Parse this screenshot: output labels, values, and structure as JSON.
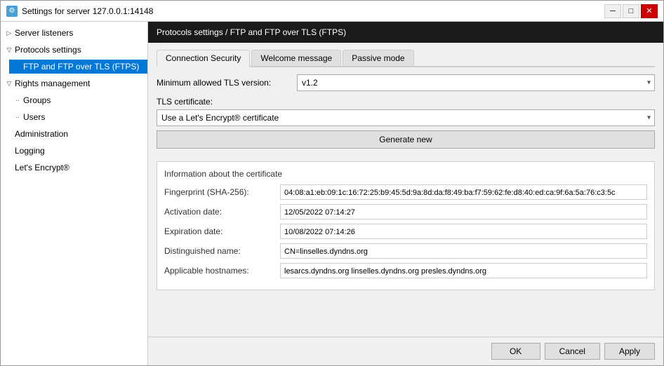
{
  "window": {
    "title": "Settings for server 127.0.0.1:14148",
    "icon": "⚙"
  },
  "sidebar": {
    "items": [
      {
        "id": "server-listeners",
        "label": "Server listeners",
        "indent": 0,
        "expanded": true,
        "selected": false
      },
      {
        "id": "protocols-settings",
        "label": "Protocols settings",
        "indent": 0,
        "expanded": true,
        "selected": false
      },
      {
        "id": "ftp-ftps",
        "label": "FTP and FTP over TLS (FTPS)",
        "indent": 2,
        "expanded": false,
        "selected": true
      },
      {
        "id": "rights-management",
        "label": "Rights management",
        "indent": 0,
        "expanded": true,
        "selected": false
      },
      {
        "id": "groups",
        "label": "Groups",
        "indent": 1,
        "expanded": false,
        "selected": false
      },
      {
        "id": "users",
        "label": "Users",
        "indent": 1,
        "expanded": false,
        "selected": false
      },
      {
        "id": "administration",
        "label": "Administration",
        "indent": 0,
        "expanded": false,
        "selected": false
      },
      {
        "id": "logging",
        "label": "Logging",
        "indent": 0,
        "expanded": false,
        "selected": false
      },
      {
        "id": "lets-encrypt",
        "label": "Let's Encrypt®",
        "indent": 0,
        "expanded": false,
        "selected": false
      }
    ]
  },
  "panel": {
    "header": "Protocols settings / FTP and FTP over TLS (FTPS)",
    "tabs": [
      {
        "id": "connection-security",
        "label": "Connection Security",
        "active": true
      },
      {
        "id": "welcome-message",
        "label": "Welcome message",
        "active": false
      },
      {
        "id": "passive-mode",
        "label": "Passive mode",
        "active": false
      }
    ],
    "tls_version_label": "Minimum allowed TLS version:",
    "tls_version_value": "v1.2",
    "tls_cert_label": "TLS certificate:",
    "tls_cert_value": "Use a Let's Encrypt® certificate",
    "generate_btn": "Generate new",
    "cert_info": {
      "title": "Information about the certificate",
      "fields": [
        {
          "label": "Fingerprint (SHA-256):",
          "value": "04:08:a1:eb:09:1c:16:72:25:b9:45:5d:9a:8d:da:f8:49:ba:f7:59:62:fe:d8:40:ed:ca:9f:6a:5a:76:c3:5c"
        },
        {
          "label": "Activation date:",
          "value": "12/05/2022 07:14:27"
        },
        {
          "label": "Expiration date:",
          "value": "10/08/2022 07:14:26"
        },
        {
          "label": "Distinguished name:",
          "value": "CN=linselles.dyndns.org"
        },
        {
          "label": "Applicable hostnames:",
          "value": "lesarcs.dyndns.org linselles.dyndns.org presles.dyndns.org"
        }
      ]
    }
  },
  "buttons": {
    "ok": "OK",
    "cancel": "Cancel",
    "apply": "Apply"
  }
}
